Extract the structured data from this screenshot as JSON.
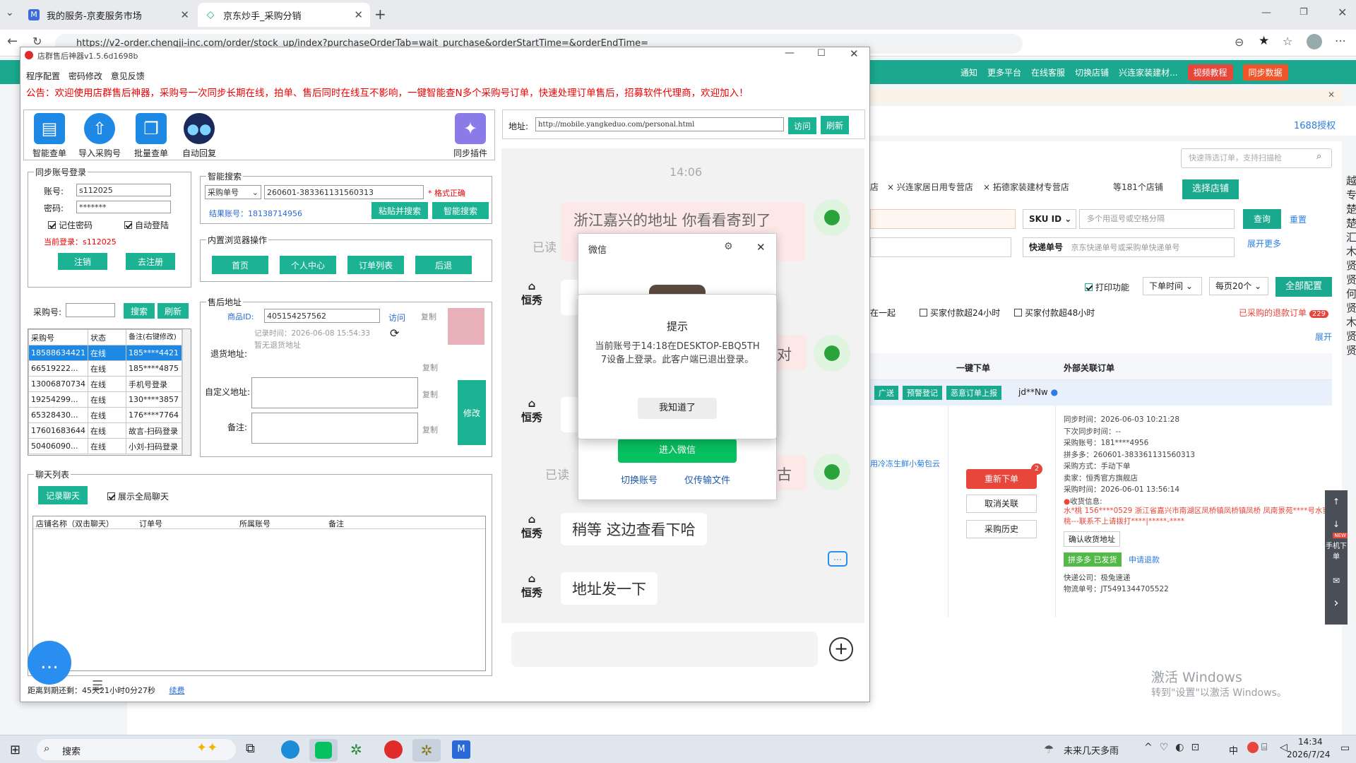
{
  "browser": {
    "tabs": [
      {
        "label": "我的服务-京麦服务市场",
        "icon": "M"
      },
      {
        "label": "京东炒手_采购分销",
        "icon": "◇"
      }
    ],
    "url": "https://v2-order.chengji-inc.com/order/stock_up/index?purchaseOrderTab=wait_purchase&orderStartTime=&orderEndTime="
  },
  "web": {
    "header_links": [
      "通知",
      "更多平台",
      "在线客服",
      "切换店铺",
      "兴连家装建材..."
    ],
    "video_btn": "视频教程",
    "sync_btn": "同步数据",
    "auth_1688": "1688授权",
    "quick_search_placeholder": "快速筛选订单，支持扫描枪",
    "store_tags": [
      "店",
      "兴连家居日用专营店",
      "拓德家装建材专营店"
    ],
    "store_count": "等181个店铺",
    "select_store": "选择店铺",
    "sku_label": "SKU ID",
    "sku_placeholder": "多个用逗号或空格分隔",
    "query_btn": "查询",
    "reset_btn": "重置",
    "express_label": "快递单号",
    "express_placeholder": "京东快递单号或采购单快递单号",
    "expand_more": "展开更多",
    "print_fn": "打印功能",
    "order_time": "下单时间",
    "per_page": "每页20个",
    "all_config": "全部配置",
    "together": "在一起",
    "buyer24": "买家付款超24小时",
    "buyer48": "买家付款超48小时",
    "refund_label": "已采购的退款订单",
    "refund_count": "229",
    "expand": "展开",
    "col_oneclick": "一键下单",
    "col_external": "外部关联订单",
    "tag_guangsong": "广送",
    "tag_yujing": "预警登记",
    "tag_eyi": "恶意订单上报",
    "jd_user": "jd**Nw",
    "product_snippet": "用冷冻生鲜小菊包云",
    "reorder": "重新下单",
    "reorder_badge": "2",
    "cancel_link": "取消关联",
    "purchase_history": "采购历史",
    "detail": [
      "同步时间：2026-06-03 10:21:28",
      "下次同步时间：--",
      "采购账号：181****4956",
      "拼多多：260601-383361131560313",
      "采购方式：手动下单",
      "卖家：恒秀官方旗舰店",
      "采购时间：2026-06-01 13:56:14"
    ],
    "recv_title": "收货信息:",
    "recv_addr": "水*桃 156****0529 浙江省嘉兴市南湖区凤桥镇凤桥镇凤桥 凤南景苑****号水蜜桃---联系不上请拨打****|*****-****",
    "confirm_addr": "确认收货地址",
    "pdd_shipped": "拼多多 已发货",
    "apply_refund": "申请退款",
    "express_company": "快递公司：极兔速递",
    "logistics_no": "物流单号：JT5491344705522",
    "side_chars": [
      "越",
      "专",
      "楚",
      "楚",
      "汇",
      "木",
      "贤",
      "贤",
      "何",
      "贤",
      "木",
      "贤",
      "贤"
    ],
    "float_tools": [
      "↑",
      "↓",
      "手机下单",
      "✉",
      "›"
    ],
    "new_tag": "NEW",
    "activate_title": "激活 Windows",
    "activate_sub": "转到\"设置\"以激活 Windows。"
  },
  "app": {
    "title": "店群售后神器v1.5.6d1698b",
    "menu": [
      "程序配置",
      "密码修改",
      "意见反馈"
    ],
    "notice": "公告：欢迎使用店群售后神器，采购号一次同步长期在线，拍单、售后同时在线互不影响，一键智能查N多个采购号订单，快速处理订单售后，招募软件代理商，欢迎加入！",
    "toolbar": [
      "智能查单",
      "导入采购号",
      "批量查单",
      "自动回复"
    ],
    "sync_plugin": "同步插件",
    "addr_label": "地址:",
    "addr_value": "http://mobile.yangkeduo.com/personal.html",
    "visit": "访问",
    "refresh": "刷新",
    "login": {
      "legend": "同步账号登录",
      "account_label": "账号:",
      "account_value": "s112025",
      "pwd_label": "密码:",
      "pwd_value": "*******",
      "remember": "记住密码",
      "autologin": "自动登陆",
      "current": "当前登录：s112025",
      "logout": "注销",
      "deregister": "去注册"
    },
    "search": {
      "legend": "智能搜索",
      "type": "采购单号",
      "value": "260601-383361131560313",
      "valid": "* 格式正确",
      "result": "结果账号：18138714956",
      "paste_search": "粘贴并搜索",
      "smart_search": "智能搜索"
    },
    "browser_ops": {
      "legend": "内置浏览器操作",
      "buttons": [
        "首页",
        "个人中心",
        "订单列表",
        "后退"
      ]
    },
    "purchase_label": "采购号:",
    "search_btn": "搜索",
    "refresh_btn": "刷新",
    "accounts_header": [
      "采购号",
      "状态",
      "备注(右键修改)"
    ],
    "accounts": [
      [
        "18588634421",
        "在线",
        "185****4421"
      ],
      [
        "66519222...",
        "在线",
        "185****4875"
      ],
      [
        "13006870734",
        "在线",
        "手机号登录"
      ],
      [
        "19254299...",
        "在线",
        "130****3857"
      ],
      [
        "65328430...",
        "在线",
        "176****7764"
      ],
      [
        "17601683644",
        "在线",
        "故言-扫码登录"
      ],
      [
        "50406090...",
        "在线",
        "小刘-扫码登录"
      ]
    ],
    "after_sale": {
      "legend": "售后地址",
      "goods_id_label": "商品ID:",
      "goods_id": "405154257562",
      "visit": "访问",
      "copy": "复制",
      "record_time": "记录时间：2026-06-08 15:54:33",
      "return_label": "退货地址:",
      "no_return": "暂无退货地址",
      "custom_label": "自定义地址:",
      "remark_label": "备注:",
      "modify": "修改"
    },
    "chat_list": {
      "legend": "聊天列表",
      "record": "记录聊天",
      "show_all": "展示全局聊天",
      "headers": [
        "店铺名称（双击聊天）",
        "订单号",
        "所属账号",
        "备注"
      ]
    },
    "expire": "距离到期还剩：45天21小时0分27秒",
    "renew": "续费"
  },
  "chat": {
    "time": "14:06",
    "read": "已读",
    "shop_name": "恒秀",
    "messages": [
      "浙江嘉兴的地址  你看看寄到了",
      "稍等  这边查看下哈",
      "地址发一下"
    ],
    "partial_right_2": "对",
    "partial_right_3": "古"
  },
  "wechat": {
    "title": "微信",
    "enter": "进入微信",
    "switch": "切换账号",
    "transfer": "仅传输文件",
    "prompt_title": "提示",
    "prompt_msg": "当前账号于14:18在DESKTOP-EBQ5TH7设备上登录。此客户端已退出登录。",
    "ok": "我知道了"
  },
  "taskbar": {
    "search": "搜索",
    "weather": "未来几天多雨",
    "lang": "中",
    "time": "14:34",
    "date": "2026/7/24"
  }
}
